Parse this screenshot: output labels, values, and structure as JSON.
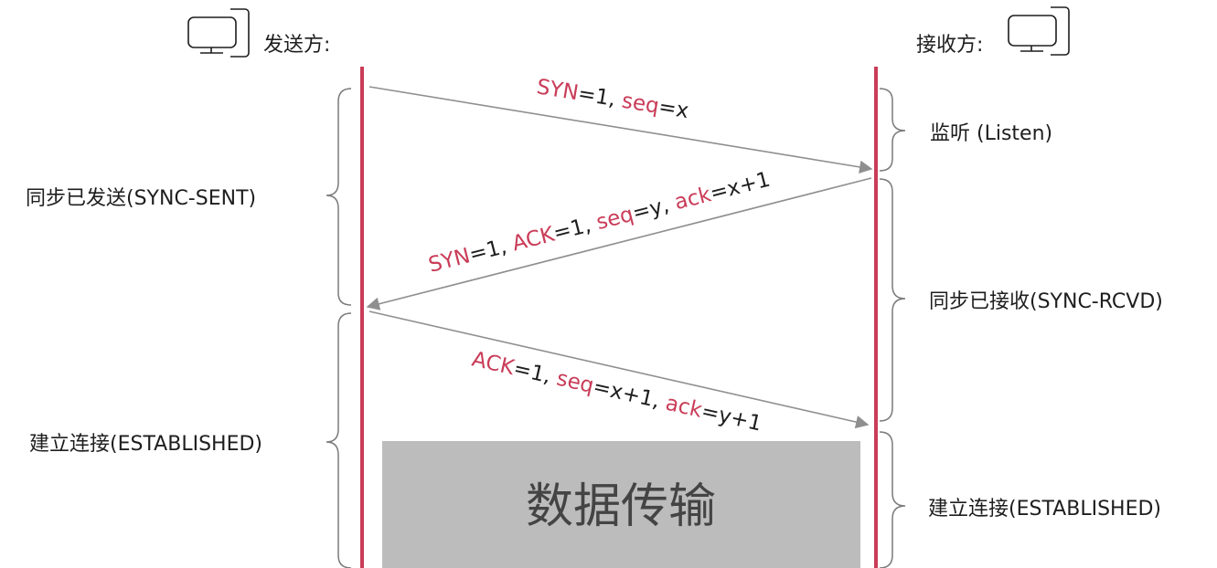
{
  "sender": {
    "label": "发送方:",
    "icon": "computer-icon"
  },
  "receiver": {
    "label": "接收方:",
    "icon": "computer-icon"
  },
  "messages": [
    {
      "parts": [
        {
          "t": "SYN",
          "h": true
        },
        {
          "t": "=1, ",
          "h": false
        },
        {
          "t": "seq",
          "h": true
        },
        {
          "t": "=x",
          "h": false
        }
      ]
    },
    {
      "parts": [
        {
          "t": "SYN",
          "h": true
        },
        {
          "t": "=1, ",
          "h": false
        },
        {
          "t": "ACK",
          "h": true
        },
        {
          "t": "=1, ",
          "h": false
        },
        {
          "t": "seq",
          "h": true
        },
        {
          "t": "=y, ",
          "h": false
        },
        {
          "t": "ack",
          "h": true
        },
        {
          "t": "=x+1",
          "h": false
        }
      ]
    },
    {
      "parts": [
        {
          "t": "ACK",
          "h": true
        },
        {
          "t": "=1, ",
          "h": false
        },
        {
          "t": "seq",
          "h": true
        },
        {
          "t": "=x+1, ",
          "h": false
        },
        {
          "t": "ack",
          "h": true
        },
        {
          "t": "=y+1",
          "h": false
        }
      ]
    }
  ],
  "left_states": [
    "同步已发送(SYNC-SENT)",
    "建立连接(ESTABLISHED)"
  ],
  "right_states": [
    "监听 (Listen)",
    "同步已接收(SYNC-RCVD)",
    "建立连接(ESTABLISHED)"
  ],
  "data_box": "数据传输",
  "colors": {
    "lifeline": "#c93c58",
    "highlight": "#c93c58",
    "arrow": "#8f8f8f",
    "data_box": "#bcbcbc"
  }
}
